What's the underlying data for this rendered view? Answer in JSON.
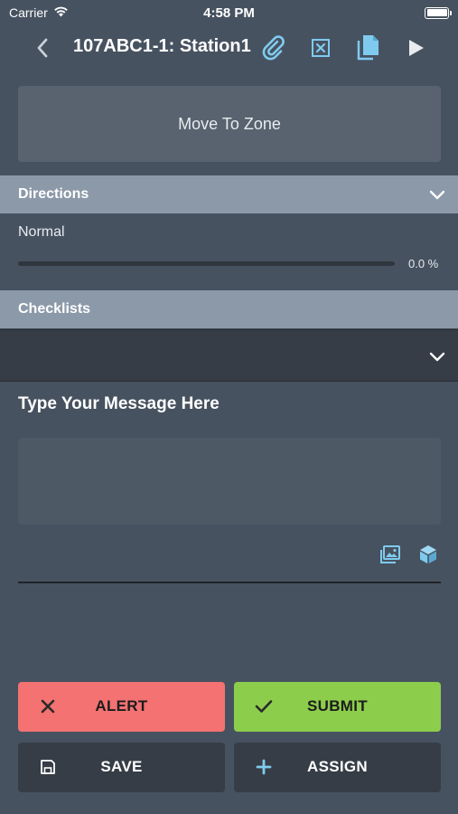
{
  "status_bar": {
    "carrier": "Carrier",
    "time": "4:58 PM"
  },
  "nav": {
    "title": "107ABC1-1: Station1",
    "icons": [
      "back-chevron-icon",
      "paperclip-icon",
      "excel-icon",
      "copy-icon",
      "play-icon"
    ],
    "accent_color": "#7fcbef"
  },
  "zone": {
    "button_label": "Move To Zone"
  },
  "directions": {
    "header": "Directions",
    "value": "Normal",
    "progress": 0.0,
    "progress_text": "0.0 %"
  },
  "checklists": {
    "header": "Checklists",
    "selected": ""
  },
  "message": {
    "title": "Type Your Message Here",
    "value": "",
    "placeholder": ""
  },
  "actions": {
    "alert_label": "ALERT",
    "submit_label": "SUBMIT",
    "save_label": "SAVE",
    "assign_label": "ASSIGN",
    "alert_color": "#f47272",
    "submit_color": "#8ccd4c"
  }
}
